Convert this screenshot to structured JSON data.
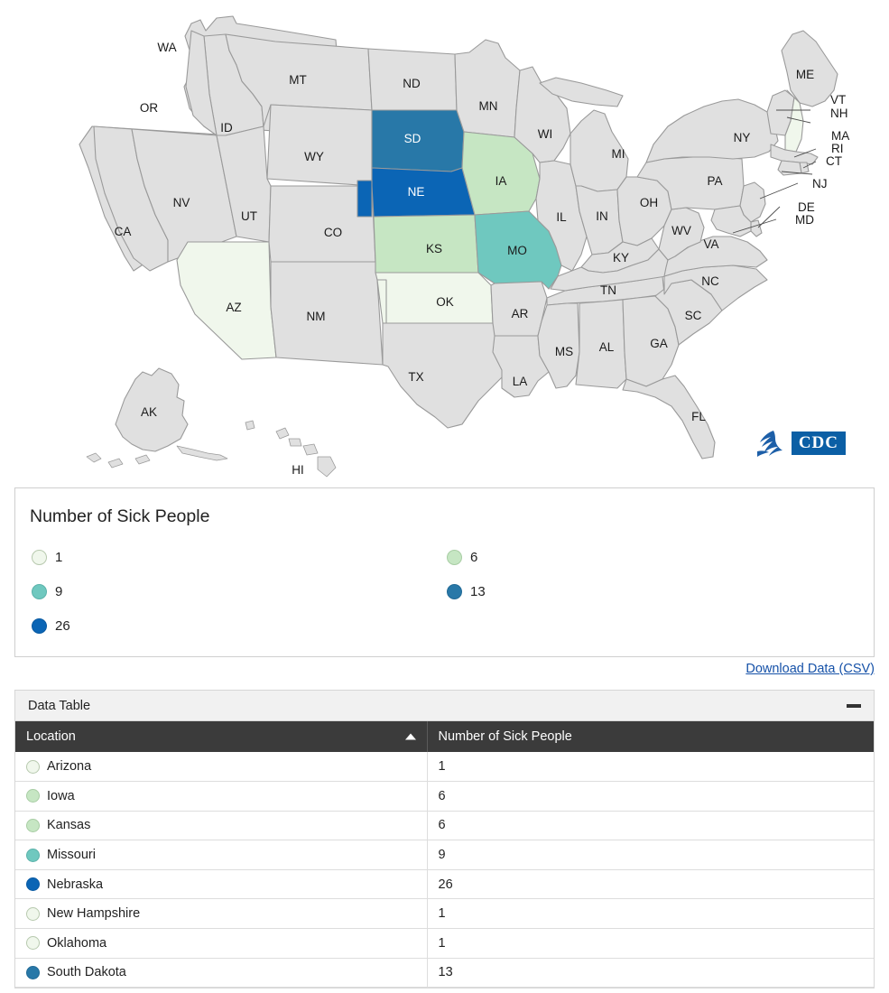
{
  "colors": {
    "no_data": "#e0e0e0",
    "bin_1": "#f0f7ec",
    "bin_6": "#c6e6c3",
    "bin_9": "#6fc8bf",
    "bin_13": "#2878a8",
    "bin_26": "#0b65b5",
    "stroke": "#9a9a9a",
    "header_bg": "#3b3b3b",
    "panel_head_bg": "#f1f1f1",
    "link": "#1551a8",
    "cdc_blue": "#0b5fa5"
  },
  "map": {
    "name": "us-choropleth-map",
    "states": [
      {
        "code": "WA",
        "value": null
      },
      {
        "code": "OR",
        "value": null
      },
      {
        "code": "CA",
        "value": null
      },
      {
        "code": "NV",
        "value": null
      },
      {
        "code": "ID",
        "value": null
      },
      {
        "code": "MT",
        "value": null
      },
      {
        "code": "WY",
        "value": null
      },
      {
        "code": "UT",
        "value": null
      },
      {
        "code": "AZ",
        "value": 1
      },
      {
        "code": "CO",
        "value": null
      },
      {
        "code": "NM",
        "value": null
      },
      {
        "code": "ND",
        "value": null
      },
      {
        "code": "SD",
        "value": 13
      },
      {
        "code": "NE",
        "value": 26
      },
      {
        "code": "KS",
        "value": 6
      },
      {
        "code": "OK",
        "value": 1
      },
      {
        "code": "TX",
        "value": null
      },
      {
        "code": "MN",
        "value": null
      },
      {
        "code": "IA",
        "value": 6
      },
      {
        "code": "MO",
        "value": 9
      },
      {
        "code": "AR",
        "value": null
      },
      {
        "code": "LA",
        "value": null
      },
      {
        "code": "WI",
        "value": null
      },
      {
        "code": "IL",
        "value": null
      },
      {
        "code": "MI",
        "value": null
      },
      {
        "code": "IN",
        "value": null
      },
      {
        "code": "OH",
        "value": null
      },
      {
        "code": "KY",
        "value": null
      },
      {
        "code": "TN",
        "value": null
      },
      {
        "code": "MS",
        "value": null
      },
      {
        "code": "AL",
        "value": null
      },
      {
        "code": "GA",
        "value": null
      },
      {
        "code": "FL",
        "value": null
      },
      {
        "code": "SC",
        "value": null
      },
      {
        "code": "NC",
        "value": null
      },
      {
        "code": "VA",
        "value": null
      },
      {
        "code": "WV",
        "value": null
      },
      {
        "code": "PA",
        "value": null
      },
      {
        "code": "NY",
        "value": null
      },
      {
        "code": "ME",
        "value": null
      },
      {
        "code": "VT",
        "value": null
      },
      {
        "code": "NH",
        "value": 1
      },
      {
        "code": "MA",
        "value": null
      },
      {
        "code": "RI",
        "value": null
      },
      {
        "code": "CT",
        "value": null
      },
      {
        "code": "NJ",
        "value": null
      },
      {
        "code": "DE",
        "value": null
      },
      {
        "code": "MD",
        "value": null
      },
      {
        "code": "AK",
        "value": null
      },
      {
        "code": "HI",
        "value": null
      }
    ],
    "logos": {
      "hhs_alt": "hhs-eagle-logo",
      "cdc_text": "CDC"
    }
  },
  "legend": {
    "title": "Number of Sick People",
    "items": [
      {
        "label": "1",
        "color": "#f0f7ec"
      },
      {
        "label": "6",
        "color": "#c6e6c3"
      },
      {
        "label": "9",
        "color": "#6fc8bf"
      },
      {
        "label": "13",
        "color": "#2878a8"
      },
      {
        "label": "26",
        "color": "#0b65b5"
      }
    ]
  },
  "download": {
    "label": "Download Data (CSV)"
  },
  "data_table": {
    "panel_title": "Data Table",
    "collapse_state": "expanded",
    "columns": [
      {
        "key": "location",
        "label": "Location",
        "sorted": "asc"
      },
      {
        "key": "count",
        "label": "Number of Sick People",
        "sorted": null
      }
    ],
    "rows": [
      {
        "location": "Arizona",
        "count": "1",
        "color": "#f0f7ec"
      },
      {
        "location": "Iowa",
        "count": "6",
        "color": "#c6e6c3"
      },
      {
        "location": "Kansas",
        "count": "6",
        "color": "#c6e6c3"
      },
      {
        "location": "Missouri",
        "count": "9",
        "color": "#6fc8bf"
      },
      {
        "location": "Nebraska",
        "count": "26",
        "color": "#0b65b5"
      },
      {
        "location": "New Hampshire",
        "count": "1",
        "color": "#f0f7ec"
      },
      {
        "location": "Oklahoma",
        "count": "1",
        "color": "#f0f7ec"
      },
      {
        "location": "South Dakota",
        "count": "13",
        "color": "#2878a8"
      }
    ]
  },
  "chart_data": {
    "type": "map",
    "title": "Number of Sick People",
    "categories": [
      "Arizona",
      "Iowa",
      "Kansas",
      "Missouri",
      "Nebraska",
      "New Hampshire",
      "Oklahoma",
      "South Dakota"
    ],
    "values": [
      1,
      6,
      6,
      9,
      26,
      1,
      1,
      13
    ],
    "legend_breaks": [
      1,
      6,
      9,
      13,
      26
    ],
    "legend_position": "below-map",
    "xlabel": "Location",
    "ylabel": "Number of Sick People"
  }
}
